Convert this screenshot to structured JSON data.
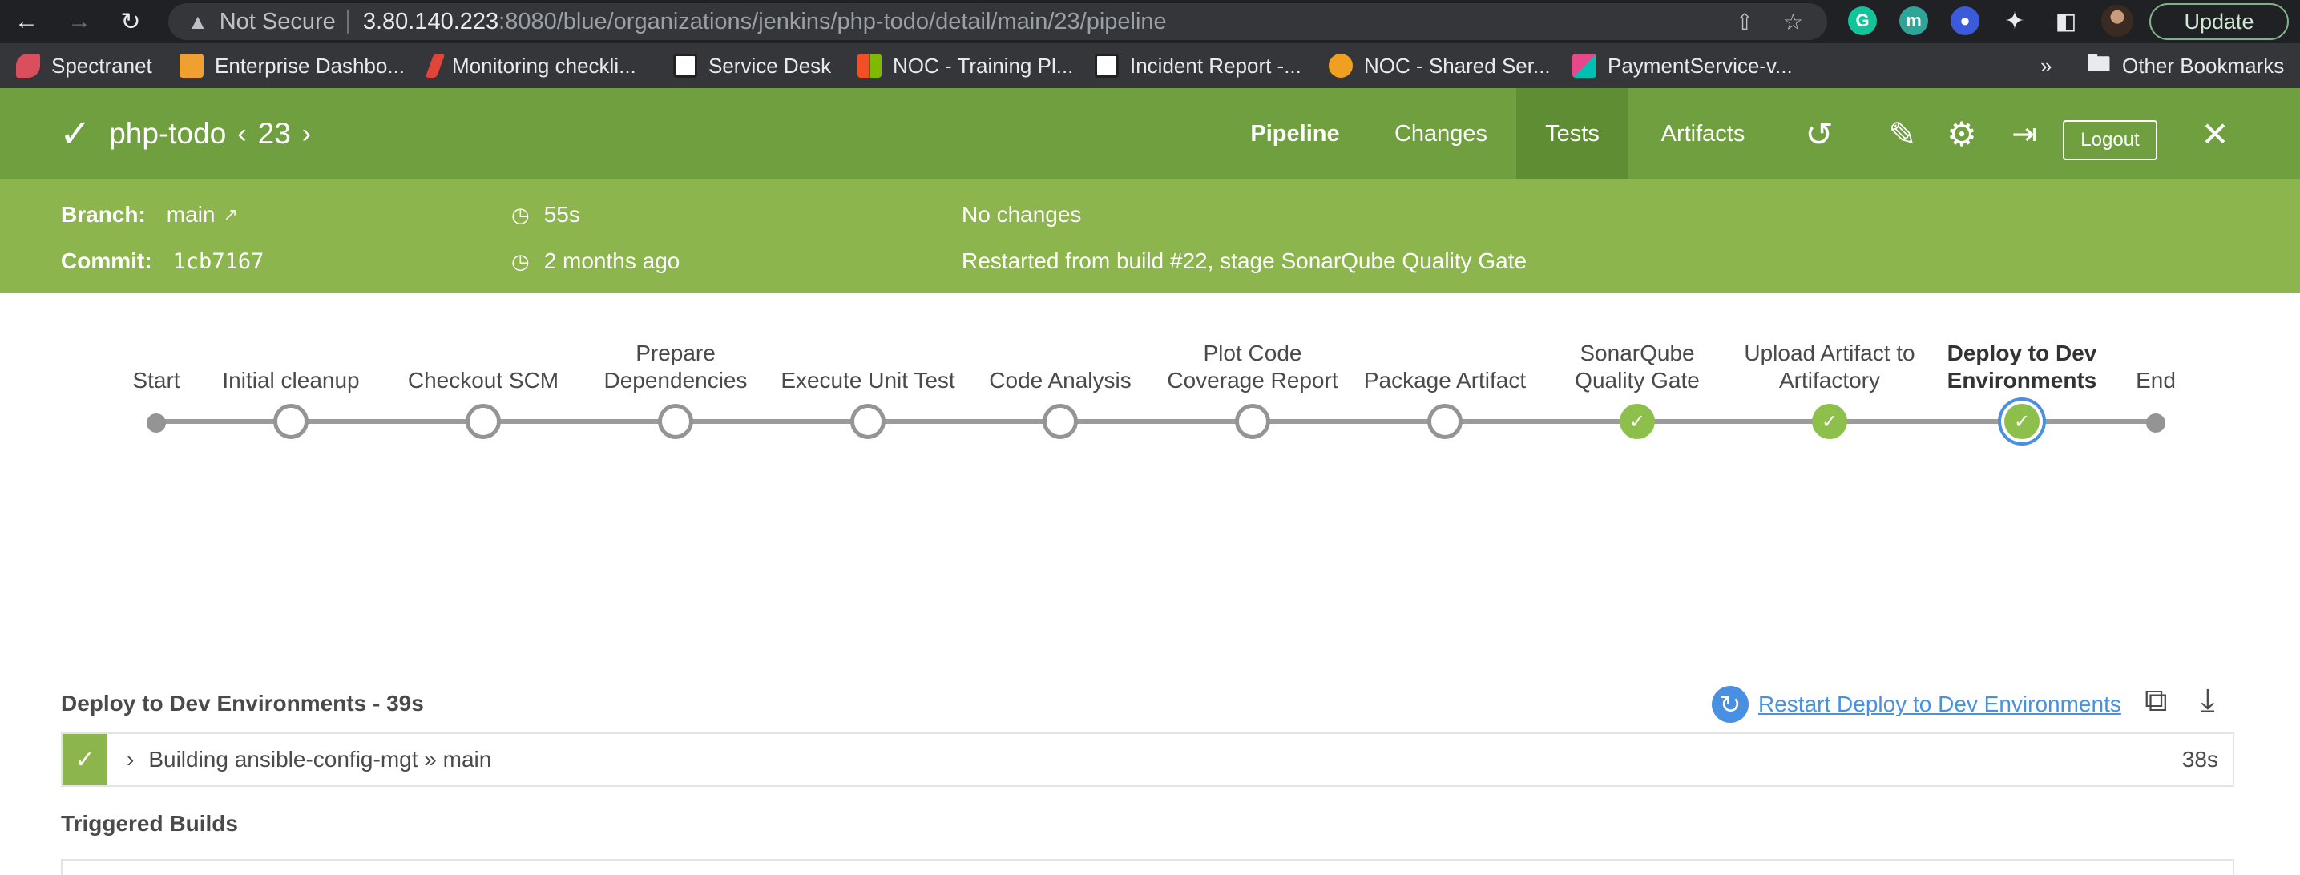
{
  "browser": {
    "security_label": "Not Secure",
    "url_host": "3.80.140.223",
    "url_path": ":8080/blue/organizations/jenkins/php-todo/detail/main/23/pipeline",
    "update_label": "Update",
    "bookmarks": [
      {
        "label": "Spectranet",
        "color": "#d94f5c"
      },
      {
        "label": "Enterprise Dashbo...",
        "color": "#f0a030"
      },
      {
        "label": "Monitoring checkli...",
        "color": "#e0443a"
      },
      {
        "label": "Service Desk",
        "color": "#ffffff"
      },
      {
        "label": "NOC - Training Pl...",
        "color": "#f25022"
      },
      {
        "label": "Incident Report -...",
        "color": "#ffffff"
      },
      {
        "label": "NOC - Shared Ser...",
        "color": "#f0a020"
      },
      {
        "label": "PaymentService-v...",
        "color": "#e8478b"
      }
    ],
    "overflow_label": "»",
    "other_bookmarks": "Other Bookmarks"
  },
  "header": {
    "project": "php-todo",
    "build_number": "23",
    "tabs": {
      "pipeline": "Pipeline",
      "changes": "Changes",
      "tests": "Tests",
      "artifacts": "Artifacts"
    },
    "logout_label": "Logout"
  },
  "summary": {
    "branch_label": "Branch:",
    "branch_value": "main",
    "commit_label": "Commit:",
    "commit_value": "1cb7167",
    "duration": "55s",
    "time_ago": "2 months ago",
    "changes": "No changes",
    "cause": "Restarted from build #22, stage SonarQube Quality Gate"
  },
  "pipeline": {
    "stages": [
      {
        "line1": "",
        "line2": "Start",
        "status": "start"
      },
      {
        "line1": "",
        "line2": "Initial cleanup",
        "status": "skipped"
      },
      {
        "line1": "",
        "line2": "Checkout SCM",
        "status": "skipped"
      },
      {
        "line1": "Prepare",
        "line2": "Dependencies",
        "status": "skipped"
      },
      {
        "line1": "",
        "line2": "Execute Unit Test",
        "status": "skipped"
      },
      {
        "line1": "",
        "line2": "Code Analysis",
        "status": "skipped"
      },
      {
        "line1": "Plot Code",
        "line2": "Coverage Report",
        "status": "skipped"
      },
      {
        "line1": "",
        "line2": "Package Artifact",
        "status": "skipped"
      },
      {
        "line1": "SonarQube",
        "line2": "Quality Gate",
        "status": "success"
      },
      {
        "line1": "Upload Artifact to",
        "line2": "Artifactory",
        "status": "success"
      },
      {
        "line1": "Deploy to Dev",
        "line2": "Environments",
        "status": "success-selected"
      },
      {
        "line1": "",
        "line2": "End",
        "status": "end"
      }
    ]
  },
  "step": {
    "title": "Deploy to Dev Environments - 39s",
    "restart_label": "Restart Deploy to Dev Environments",
    "log_text": "Building ansible-config-mgt » main",
    "log_duration": "38s"
  },
  "triggered_label": "Triggered Builds"
}
